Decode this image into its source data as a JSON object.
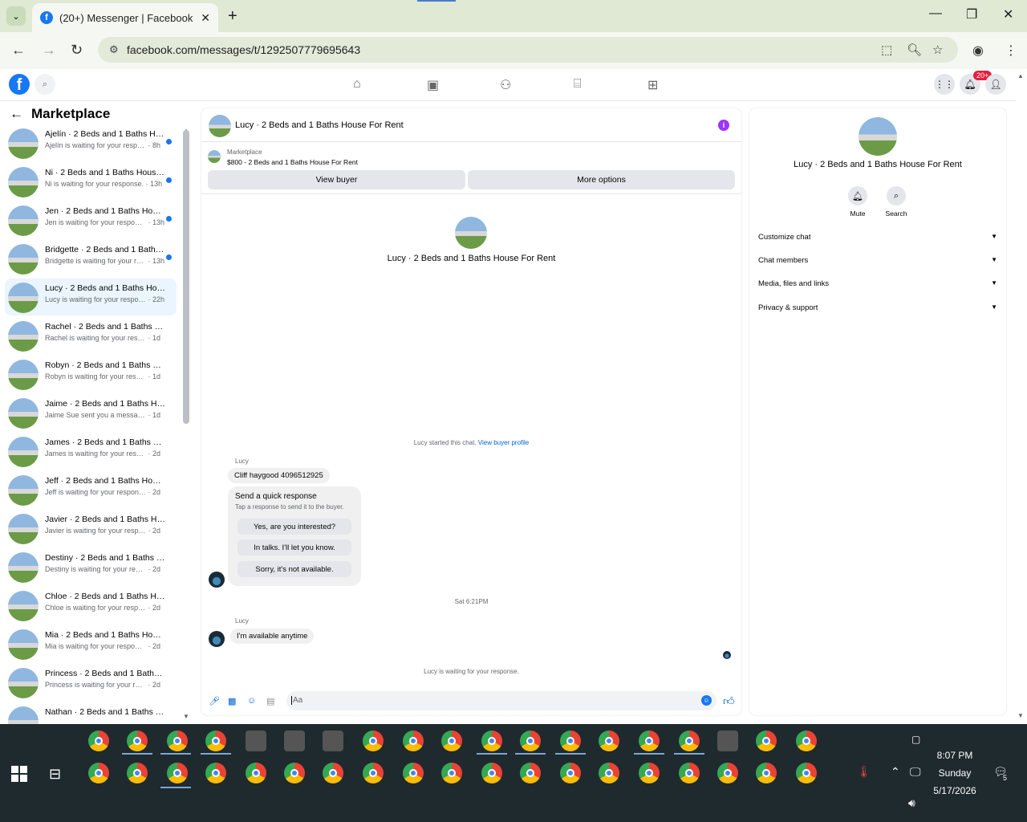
{
  "browser": {
    "tab_title": "(20+) Messenger | Facebook",
    "favicon": "f",
    "url": "facebook.com/messages/t/1292507779695643"
  },
  "fb_header": {
    "notifications_badge": "20+"
  },
  "sidebar": {
    "title": "Marketplace",
    "conversations": [
      {
        "title": "Ajelín · 2 Beds and 1 Baths House For Rent",
        "status": "Ajelín is waiting for your response.",
        "time": "8h",
        "unread": true
      },
      {
        "title": "Ni · 2 Beds and 1 Baths House For Rent",
        "status": "Ni is waiting for your response.",
        "time": "13h",
        "unread": true
      },
      {
        "title": "Jen · 2 Beds and 1 Baths House For Rent",
        "status": "Jen is waiting for your response.",
        "time": "13h",
        "unread": true
      },
      {
        "title": "Bridgette · 2 Beds and 1 Baths House For Rent",
        "status": "Bridgette is waiting for your response.",
        "time": "13h",
        "unread": true
      },
      {
        "title": "Lucy · 2 Beds and 1 Baths House For Rent",
        "status": "Lucy is waiting for your response.",
        "time": "22h",
        "unread": false,
        "active": true
      },
      {
        "title": "Rachel · 2 Beds and 1 Baths House For Rent",
        "status": "Rachel is waiting for your response.",
        "time": "1d",
        "unread": false
      },
      {
        "title": "Robyn · 2 Beds and 1 Baths House For Rent",
        "status": "Robyn is waiting for your response.",
        "time": "1d",
        "unread": false
      },
      {
        "title": "Jaime · 2 Beds and 1 Baths House For Rent",
        "status": "Jaime Sue sent you a message about your listing.",
        "time": "1d",
        "unread": false
      },
      {
        "title": "James · 2 Beds and 1 Baths House For Rent",
        "status": "James is waiting for your response.",
        "time": "2d",
        "unread": false
      },
      {
        "title": "Jeff · 2 Beds and 1 Baths House For Rent",
        "status": "Jeff is waiting for your response.",
        "time": "2d",
        "unread": false
      },
      {
        "title": "Javier · 2 Beds and 1 Baths House For Rent",
        "status": "Javier is waiting for your response.",
        "time": "2d",
        "unread": false
      },
      {
        "title": "Destiny · 2 Beds and 1 Baths House For Rent",
        "status": "Destiny is waiting for your response.",
        "time": "2d",
        "unread": false
      },
      {
        "title": "Chloe · 2 Beds and 1 Baths House For Rent",
        "status": "Chloe is waiting for your response.",
        "time": "2d",
        "unread": false
      },
      {
        "title": "Mia · 2 Beds and 1 Baths House For Rent",
        "status": "Mia is waiting for your response.",
        "time": "2d",
        "unread": false
      },
      {
        "title": "Princess · 2 Beds and 1 Baths House For Rent",
        "status": "Princess is waiting for your response.",
        "time": "2d",
        "unread": false
      },
      {
        "title": "Nathan · 2 Beds and 1 Baths House For Rent",
        "status": "",
        "time": "",
        "unread": false
      }
    ]
  },
  "chat": {
    "title": "Lucy · 2 Beds and 1 Baths House For Rent",
    "marketplace_label": "Marketplace",
    "listing": "$800 - 2 Beds and 1 Baths House For Rent",
    "view_buyer": "View buyer",
    "more_options": "More options",
    "profile_name": "Lucy · 2 Beds and 1 Baths House For Rent",
    "started_text": "Lucy started this chat.",
    "view_buyer_profile": "View buyer profile",
    "sender1": "Lucy",
    "message1": "Cliff haygood 4096512925",
    "quick_title": "Send a quick response",
    "quick_sub": "Tap a response to send it to the buyer.",
    "quick_replies": [
      "Yes, are you interested?",
      "In talks. I'll let you know.",
      "Sorry, it's not available."
    ],
    "timestamp": "Sat 6:21PM",
    "sender2": "Lucy",
    "message2": "I'm available anytime",
    "waiting": "Lucy is waiting for your response.",
    "composer_placeholder": "Aa"
  },
  "details": {
    "name": "Lucy · 2 Beds and 1 Baths House For Rent",
    "mute": "Mute",
    "search": "Search",
    "sections": [
      "Customize chat",
      "Chat members",
      "Media, files and links",
      "Privacy & support"
    ]
  },
  "taskbar": {
    "time": "8:07 PM",
    "day": "Sunday",
    "date": "5/17/2026",
    "notification_count": "5"
  },
  "colors": {
    "fb_blue": "#1877f2",
    "active_conv": "#ebf5ff",
    "info_purple": "#a033ff",
    "chrome_green": "#dfe9d4"
  }
}
